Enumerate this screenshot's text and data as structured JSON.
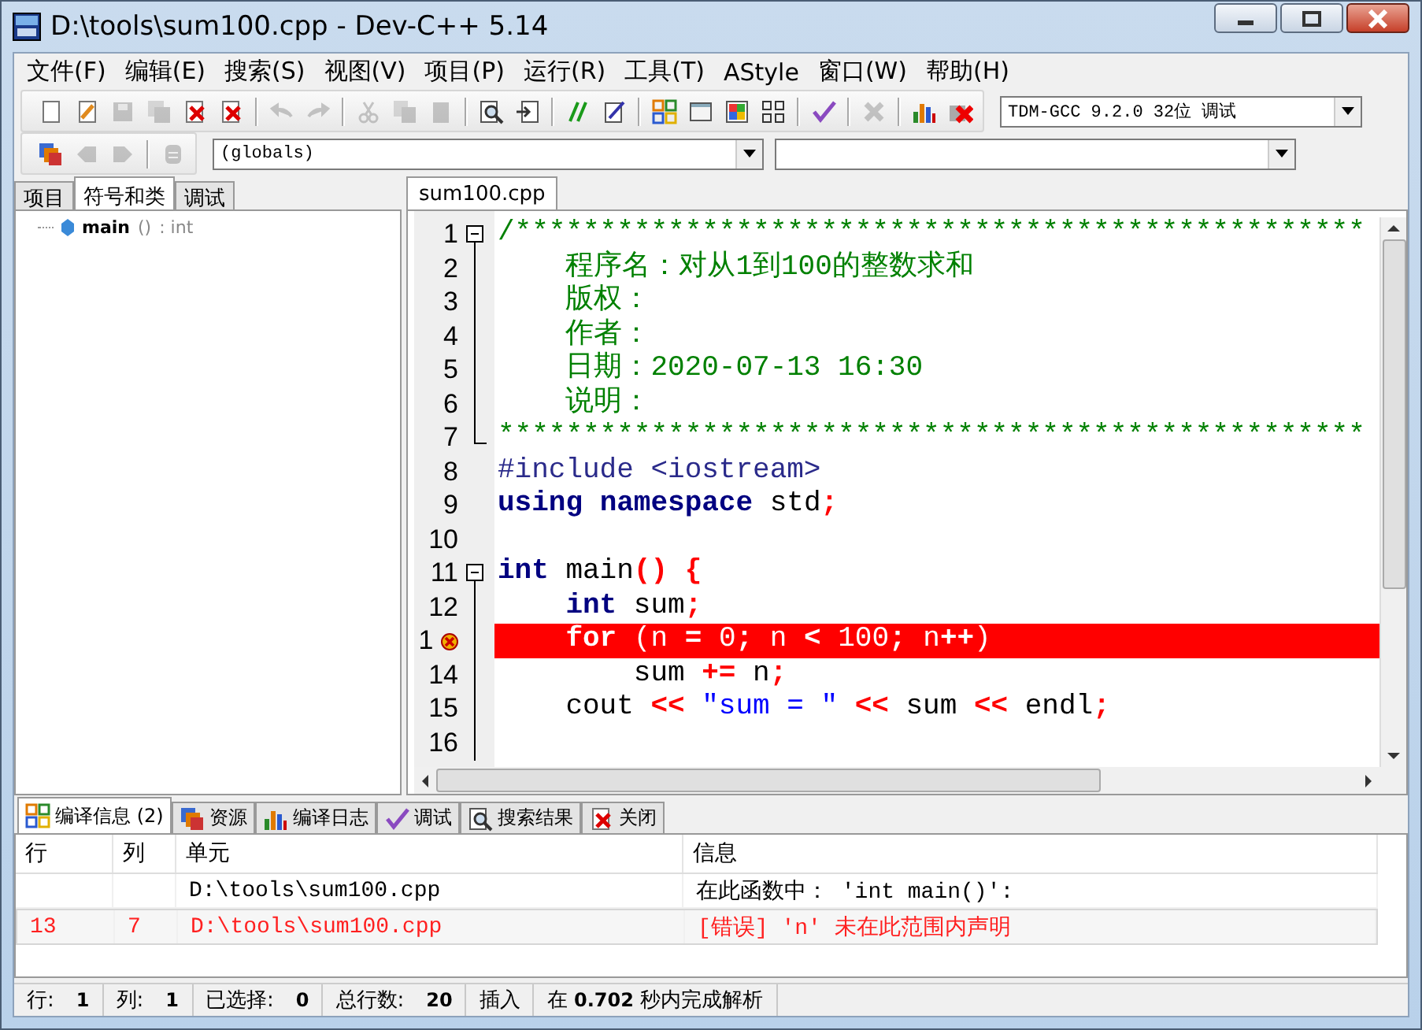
{
  "window": {
    "title": "D:\\tools\\sum100.cpp - Dev-C++ 5.14"
  },
  "menu": [
    "文件(F)",
    "编辑(E)",
    "搜索(S)",
    "视图(V)",
    "项目(P)",
    "运行(R)",
    "工具(T)",
    "AStyle",
    "窗口(W)",
    "帮助(H)"
  ],
  "toolbars": [
    {
      "groups": [
        [
          {
            "kind": "new",
            "disabled": false
          },
          {
            "kind": "open",
            "disabled": false
          },
          {
            "kind": "save",
            "disabled": true
          },
          {
            "kind": "save_all",
            "disabled": true
          },
          {
            "kind": "close",
            "disabled": false
          },
          {
            "kind": "close_all",
            "disabled": false
          }
        ],
        [
          {
            "kind": "undo",
            "disabled": true
          },
          {
            "kind": "redo",
            "disabled": true
          }
        ],
        [
          {
            "kind": "cut",
            "disabled": true
          },
          {
            "kind": "copy",
            "disabled": true
          },
          {
            "kind": "paste",
            "disabled": true
          }
        ],
        [
          {
            "kind": "find",
            "disabled": false
          },
          {
            "kind": "goto",
            "disabled": false
          }
        ],
        [
          {
            "kind": "comment",
            "disabled": false
          },
          {
            "kind": "indent",
            "disabled": false
          }
        ],
        [
          {
            "kind": "compile",
            "disabled": false
          },
          {
            "kind": "run",
            "disabled": false
          },
          {
            "kind": "compile_run",
            "disabled": false
          },
          {
            "kind": "rebuild",
            "disabled": false
          }
        ],
        [
          {
            "kind": "check",
            "disabled": false
          }
        ],
        [
          {
            "kind": "stop",
            "disabled": true
          }
        ],
        [
          {
            "kind": "chart",
            "disabled": false
          },
          {
            "kind": "debug_stop",
            "disabled": false
          }
        ]
      ],
      "dropdowns": [
        {
          "kind": "compiler",
          "value": "TDM-GCC 9.2.0 32位 调试"
        }
      ]
    },
    {
      "groups": [
        [
          {
            "kind": "windows",
            "disabled": false
          },
          {
            "kind": "prev",
            "disabled": true
          },
          {
            "kind": "next",
            "disabled": true
          }
        ],
        [
          {
            "kind": "bookmark",
            "disabled": true
          }
        ]
      ],
      "dropdowns": [
        {
          "kind": "scope",
          "value": "(globals)"
        },
        {
          "kind": "member"
        }
      ]
    }
  ],
  "left_panel": {
    "tabs": [
      {
        "label": "项目",
        "selected": false
      },
      {
        "label": "符号和类",
        "selected": true
      },
      {
        "label": "调试",
        "selected": false
      }
    ],
    "tree": [
      {
        "name": "main",
        "signature": "()",
        "type": ": int"
      }
    ]
  },
  "editor": {
    "tabs": [
      {
        "label": "sum100.cpp",
        "selected": true
      }
    ],
    "lines": [
      {
        "number": "1",
        "kind": "fold_start",
        "error": false,
        "tokens": [
          {
            "kind": "comment",
            "text": "/**************************************************"
          }
        ]
      },
      {
        "number": "2",
        "kind": "fold_body",
        "error": false,
        "tokens": [
          {
            "kind": "comment",
            "text": "    程序名：对从1到100的整数求和"
          }
        ]
      },
      {
        "number": "3",
        "kind": "fold_body",
        "error": false,
        "tokens": [
          {
            "kind": "comment",
            "text": "    版权："
          }
        ]
      },
      {
        "number": "4",
        "kind": "fold_body",
        "error": false,
        "tokens": [
          {
            "kind": "comment",
            "text": "    作者："
          }
        ]
      },
      {
        "number": "5",
        "kind": "fold_body",
        "error": false,
        "tokens": [
          {
            "kind": "comment",
            "text": "    日期：2020-07-13 16:30"
          }
        ]
      },
      {
        "number": "6",
        "kind": "fold_body",
        "error": false,
        "tokens": [
          {
            "kind": "comment",
            "text": "    说明："
          }
        ]
      },
      {
        "number": "7",
        "kind": "fold_end",
        "error": false,
        "tokens": [
          {
            "kind": "comment",
            "text": "***************************************************"
          }
        ]
      },
      {
        "number": "8",
        "kind": "plain",
        "error": false,
        "tokens": [
          {
            "kind": "preproc",
            "text": "#include <iostream>"
          }
        ]
      },
      {
        "number": "9",
        "kind": "plain",
        "error": false,
        "tokens": [
          {
            "kind": "keyword",
            "text": "using"
          },
          {
            "kind": "keyword",
            "text": " namespace"
          },
          {
            "kind": "text",
            "text": " std"
          },
          {
            "kind": "symbol",
            "text": ";"
          }
        ]
      },
      {
        "number": "10",
        "kind": "plain",
        "error": false
      },
      {
        "number": "11",
        "kind": "fold_start",
        "error": false,
        "tokens": [
          {
            "kind": "keyword",
            "text": "int"
          },
          {
            "kind": "text",
            "text": " main"
          },
          {
            "kind": "symbol",
            "text": "()"
          },
          {
            "kind": "symbol",
            "text": " {"
          }
        ]
      },
      {
        "number": "12",
        "kind": "fold_body",
        "error": false,
        "tokens": [
          {
            "kind": "keyword",
            "text": "    int"
          },
          {
            "kind": "text",
            "text": " sum"
          },
          {
            "kind": "symbol",
            "text": ";"
          }
        ]
      },
      {
        "number": "1",
        "kind": "fold_body",
        "error": true,
        "tokens": [
          {
            "kind": "keyword",
            "text": "    for"
          },
          {
            "kind": "text",
            "text": " (n "
          },
          {
            "kind": "symbol",
            "text": "="
          },
          {
            "kind": "number",
            "text": " 0"
          },
          {
            "kind": "symbol",
            "text": ";"
          },
          {
            "kind": "text",
            "text": " n "
          },
          {
            "kind": "symbol",
            "text": "<"
          },
          {
            "kind": "number",
            "text": " 100"
          },
          {
            "kind": "symbol",
            "text": ";"
          },
          {
            "kind": "text",
            "text": " n"
          },
          {
            "kind": "symbol",
            "text": "++"
          },
          {
            "kind": "text",
            "text": ")"
          }
        ]
      },
      {
        "number": "14",
        "kind": "fold_body",
        "error": false,
        "tokens": [
          {
            "kind": "text",
            "text": "        sum "
          },
          {
            "kind": "symbol",
            "text": "+="
          },
          {
            "kind": "text",
            "text": " n"
          },
          {
            "kind": "symbol",
            "text": ";"
          }
        ]
      },
      {
        "number": "15",
        "kind": "fold_body",
        "error": false,
        "tokens": [
          {
            "kind": "text",
            "text": "    cout "
          },
          {
            "kind": "symbol",
            "text": "<<"
          },
          {
            "kind": "string",
            "text": " \"sum = \""
          },
          {
            "kind": "symbol",
            "text": " <<"
          },
          {
            "kind": "text",
            "text": " sum "
          },
          {
            "kind": "symbol",
            "text": "<<"
          },
          {
            "kind": "text",
            "text": " endl"
          },
          {
            "kind": "symbol",
            "text": ";"
          }
        ]
      },
      {
        "number": "16",
        "kind": "fold_body",
        "error": false
      }
    ]
  },
  "bottom_panel": {
    "tabs": [
      {
        "kind": "compile",
        "label": "编译信息 (2)",
        "selected": true
      },
      {
        "kind": "resources",
        "label": "资源",
        "selected": false
      },
      {
        "kind": "log",
        "label": "编译日志",
        "selected": false
      },
      {
        "kind": "debug",
        "label": "调试",
        "selected": false
      },
      {
        "kind": "search",
        "label": "搜索结果",
        "selected": false
      },
      {
        "kind": "close",
        "label": "关闭",
        "selected": false
      }
    ],
    "table": {
      "columns": [
        "行",
        "列",
        "单元",
        "信息"
      ],
      "rows": [
        {
          "error": false,
          "selected": false,
          "cells": [
            null,
            null,
            "D:\\tools\\sum100.cpp",
            "在此函数中： 'int main()':"
          ]
        },
        {
          "error": true,
          "selected": true,
          "cells": [
            "13",
            "7",
            "D:\\tools\\sum100.cpp",
            "[错误] 'n' 未在此范围内声明"
          ]
        }
      ]
    }
  },
  "status_bar": [
    {
      "label": "行:",
      "value": "1"
    },
    {
      "label": "列:",
      "value": "1"
    },
    {
      "label": "已选择:",
      "value": "0"
    },
    {
      "label": "总行数:",
      "value": "20"
    },
    {
      "label": "插入"
    },
    {
      "label": "在 **0.702** 秒内完成解析"
    }
  ]
}
